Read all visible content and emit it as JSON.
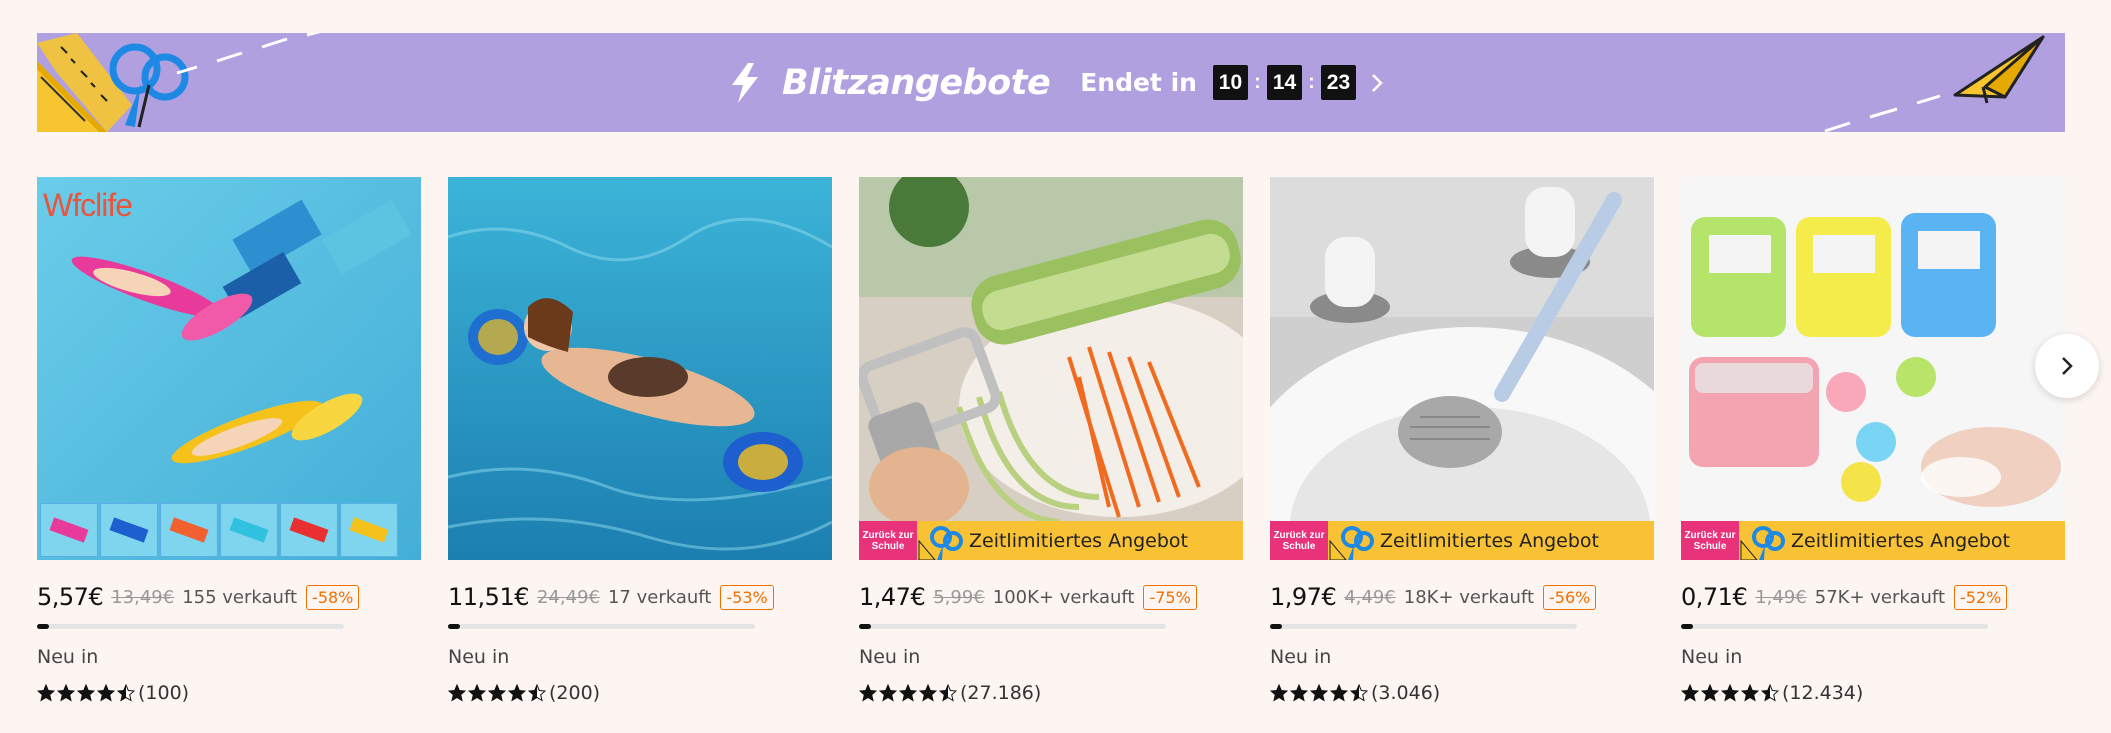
{
  "banner": {
    "title": "Blitzangebote",
    "ends_label": "Endet in",
    "timer": {
      "hours": "10",
      "minutes": "14",
      "seconds": "23",
      "sep": ":"
    },
    "bg_color": "#b0a0e0"
  },
  "promo": {
    "badge_line1": "Zurück zur",
    "badge_line2": "Schule",
    "text": "Zeitlimitiertes Angebot"
  },
  "products": [
    {
      "price": "5,57€",
      "old_price": "13,49€",
      "sold": "155 verkauft",
      "discount": "-58%",
      "progress": 0.04,
      "status": "Neu in",
      "stars": 4.5,
      "reviews": "(100)",
      "brand": "Wfclife"
    },
    {
      "price": "11,51€",
      "old_price": "24,49€",
      "sold": "17 verkauft",
      "discount": "-53%",
      "progress": 0.04,
      "status": "Neu in",
      "stars": 4.5,
      "reviews": "(200)"
    },
    {
      "price": "1,47€",
      "old_price": "5,99€",
      "sold": "100K+ verkauft",
      "discount": "-75%",
      "progress": 0.04,
      "status": "Neu in",
      "stars": 4.5,
      "reviews": "(27.186)"
    },
    {
      "price": "1,97€",
      "old_price": "4,49€",
      "sold": "18K+ verkauft",
      "discount": "-56%",
      "progress": 0.04,
      "status": "Neu in",
      "stars": 4.5,
      "reviews": "(3.046)"
    },
    {
      "price": "0,71€",
      "old_price": "1,49€",
      "sold": "57K+ verkauft",
      "discount": "-52%",
      "progress": 0.04,
      "status": "Neu in",
      "stars": 4.5,
      "reviews": "(12.434)"
    }
  ],
  "colors": {
    "discount": "#f07000",
    "promo_strip": "#f9c234",
    "promo_badge": "#e8327a"
  },
  "icons": {
    "banner": "lightning-icon",
    "timer_next": "chevron-right-icon",
    "carousel_next": "chevron-right-icon",
    "rating": "star-icon"
  }
}
